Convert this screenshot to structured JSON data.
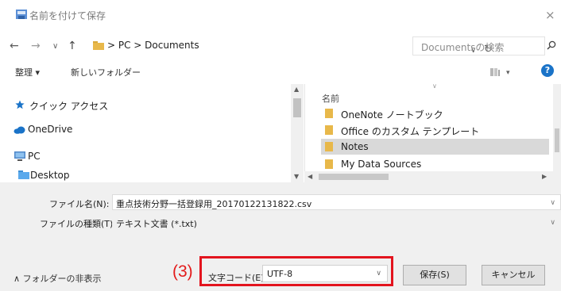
{
  "window": {
    "title": "名前を付けて保存",
    "close_glyph": "×"
  },
  "address": {
    "path": "> PC > Documents",
    "search_placeholder": "Documentsの検索"
  },
  "toolbar": {
    "organize": "整理 ▾",
    "new_folder": "新しいフォルダー"
  },
  "nav_pane": {
    "items": [
      {
        "label": "クイック アクセス",
        "icon": "star-icon"
      },
      {
        "label": "OneDrive",
        "icon": "cloud-icon"
      },
      {
        "label": "PC",
        "icon": "pc-icon"
      },
      {
        "label": "Desktop",
        "icon": "folder-icon"
      }
    ]
  },
  "file_list": {
    "column_name": "名前",
    "rows": [
      {
        "label": "OneNote ノートブック",
        "selected": false
      },
      {
        "label": "Office のカスタム テンプレート",
        "selected": false
      },
      {
        "label": "Notes",
        "selected": true
      },
      {
        "label": "My Data Sources",
        "selected": false
      }
    ]
  },
  "form": {
    "filename_label": "ファイル名(N):",
    "filename_value": "重点技術分野一括登録用_20170122131822.csv",
    "filetype_label": "ファイルの種類(T):",
    "filetype_value": "テキスト文書 (*.txt)",
    "encoding_label": "文字コード(E):",
    "encoding_value": "UTF-8"
  },
  "footer": {
    "hide_folders": "フォルダーの非表示",
    "save_button": "保存(S)",
    "cancel_button": "キャンセル"
  },
  "annotation": {
    "label": "(3)",
    "color": "#e3141e"
  },
  "colors": {
    "help_blue": "#1a73c8",
    "folder_yellow": "#e8b84a",
    "selection_gray": "#d9d9d9"
  }
}
